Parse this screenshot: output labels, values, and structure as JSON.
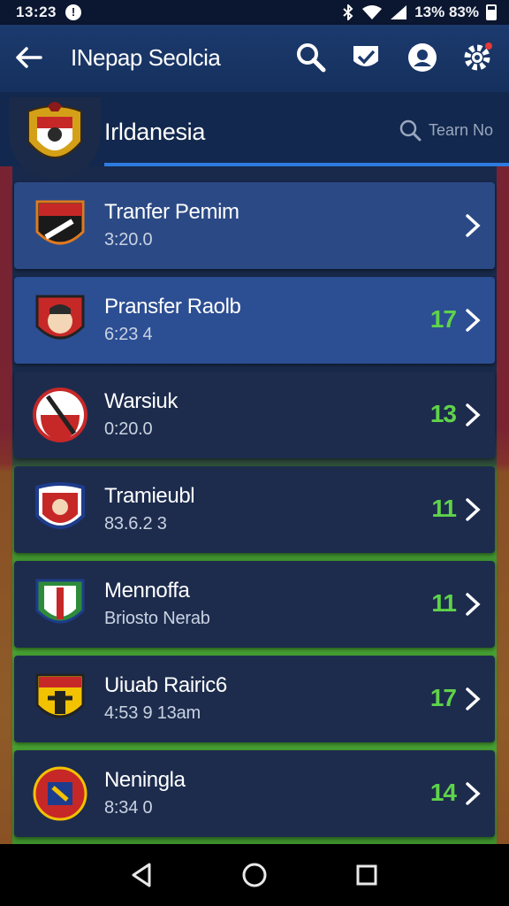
{
  "status_bar": {
    "time": "13:23",
    "battery_text": "13% 83%",
    "icons": [
      "alert-icon",
      "bluetooth-icon",
      "wifi-icon",
      "signal-icon",
      "battery-icon"
    ]
  },
  "app_bar": {
    "title": "INepap Seolcia",
    "icons": [
      "back-arrow-icon",
      "search-icon",
      "shield-check-icon",
      "profile-icon",
      "settings-icon"
    ],
    "notification_dot_color": "#e53935"
  },
  "team": {
    "name": "Irldanesia",
    "search_placeholder": "Tearn No"
  },
  "colors": {
    "accent": "#2e7be0",
    "count_green": "#5fd34a",
    "highlight_row": "#2b4a85"
  },
  "rows": [
    {
      "name": "Tranfer Pemim",
      "sub": "3:20.0",
      "count": ""
    },
    {
      "name": "Pransfer Raolb",
      "sub": "6:23 4",
      "count": "17"
    },
    {
      "name": "Warsiuk",
      "sub": "0:20.0",
      "count": "13"
    },
    {
      "name": "Tramieubl",
      "sub": "83.6.2 3",
      "count": "11"
    },
    {
      "name": "Mennoffa",
      "sub": "Briosto Nerab",
      "count": "11"
    },
    {
      "name": "Uiuab Rairic6",
      "sub": "4:53 9  13am",
      "count": "17"
    },
    {
      "name": "Neningla",
      "sub": "8:34 0",
      "count": "14"
    }
  ],
  "nav_bar": {
    "icons": [
      "back-triangle-icon",
      "home-circle-icon",
      "recents-square-icon"
    ]
  }
}
